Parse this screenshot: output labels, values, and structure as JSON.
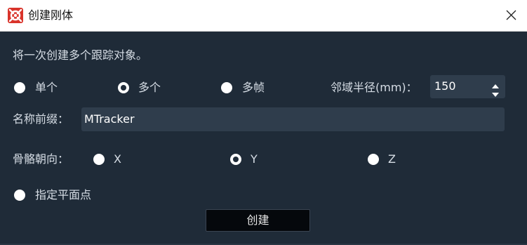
{
  "window": {
    "title": "创建刚体"
  },
  "description": "将一次创建多个跟踪对象。",
  "mode": {
    "options": [
      {
        "label": "单个",
        "selected": false
      },
      {
        "label": "多个",
        "selected": true
      },
      {
        "label": "多帧",
        "selected": false
      }
    ]
  },
  "neighborhood": {
    "label": "邻域半径(mm)：",
    "value": "150"
  },
  "prefix": {
    "label": "名称前缀：",
    "value": "MTracker"
  },
  "orientation": {
    "label": "骨骼朝向：",
    "options": [
      {
        "label": "X",
        "selected": false
      },
      {
        "label": "Y",
        "selected": true
      },
      {
        "label": "Z",
        "selected": false
      }
    ]
  },
  "plane_point": {
    "label": "指定平面点",
    "selected": false
  },
  "create_button": {
    "label": "创建"
  },
  "colors": {
    "background": "#1f2b38",
    "field": "#2f3d4c",
    "button": "#05080c",
    "icon_red": "#d9342b"
  }
}
